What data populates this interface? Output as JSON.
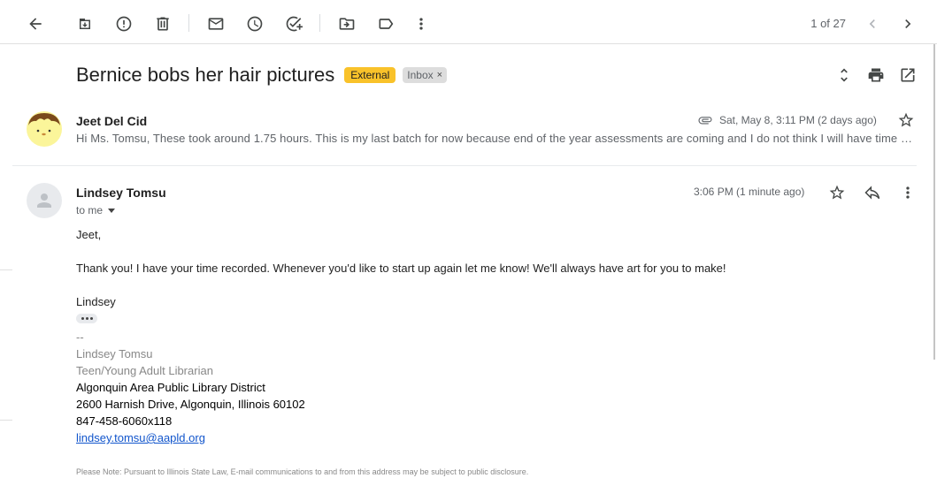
{
  "toolbar": {
    "buttons": [
      {
        "name": "back-button",
        "icon": "arrow-back-icon"
      },
      {
        "name": "archive-button",
        "icon": "archive-icon"
      },
      {
        "name": "report-spam-button",
        "icon": "report-icon"
      },
      {
        "name": "delete-button",
        "icon": "trash-icon"
      },
      {
        "name": "mark-unread-button",
        "icon": "mail-icon"
      },
      {
        "name": "snooze-button",
        "icon": "clock-icon"
      },
      {
        "name": "add-to-tasks-button",
        "icon": "add-task-icon"
      },
      {
        "name": "move-to-button",
        "icon": "move-folder-icon"
      },
      {
        "name": "labels-button",
        "icon": "label-icon"
      },
      {
        "name": "more-button",
        "icon": "more-vert-icon"
      }
    ],
    "pager": "1 of 27"
  },
  "thread": {
    "subject": "Bernice bobs her hair pictures",
    "labels": {
      "external": "External",
      "inbox": "Inbox"
    },
    "inbox_remove": "×"
  },
  "messages": [
    {
      "sender": "Jeet Del Cid",
      "date": "Sat, May 8, 3:11 PM (2 days ago)",
      "snippet": "Hi Ms. Tomsu, These took around 1.75 hours. This is my last batch for now because end of the year assessments are coming and I do not think I will have time to do any more until summer.",
      "has_attachment": true
    },
    {
      "sender": "Lindsey Tomsu",
      "to": "to me",
      "date": "3:06 PM (1 minute ago)",
      "greeting": "Jeet,",
      "body": "Thank you! I have your time recorded. Whenever you'd like to start up again let me know! We'll always have art for you to make!",
      "signoff": "Lindsey",
      "signature": {
        "separator": "--",
        "name": "Lindsey Tomsu",
        "title": "Teen/Young Adult Librarian",
        "org": "Algonquin Area Public Library District",
        "address": "2600 Harnish Drive, Algonquin, Illinois 60102",
        "phone": "847-458-6060x118",
        "email": "lindsey.tomsu@aapld.org",
        "disclaimer": "Please Note: Pursuant to Illinois State Law, E-mail communications to and from this address may be subject to public disclosure."
      }
    }
  ],
  "colors": {
    "external_label": "#f9c22a",
    "inbox_label": "#dddddd",
    "link": "#1155cc"
  }
}
